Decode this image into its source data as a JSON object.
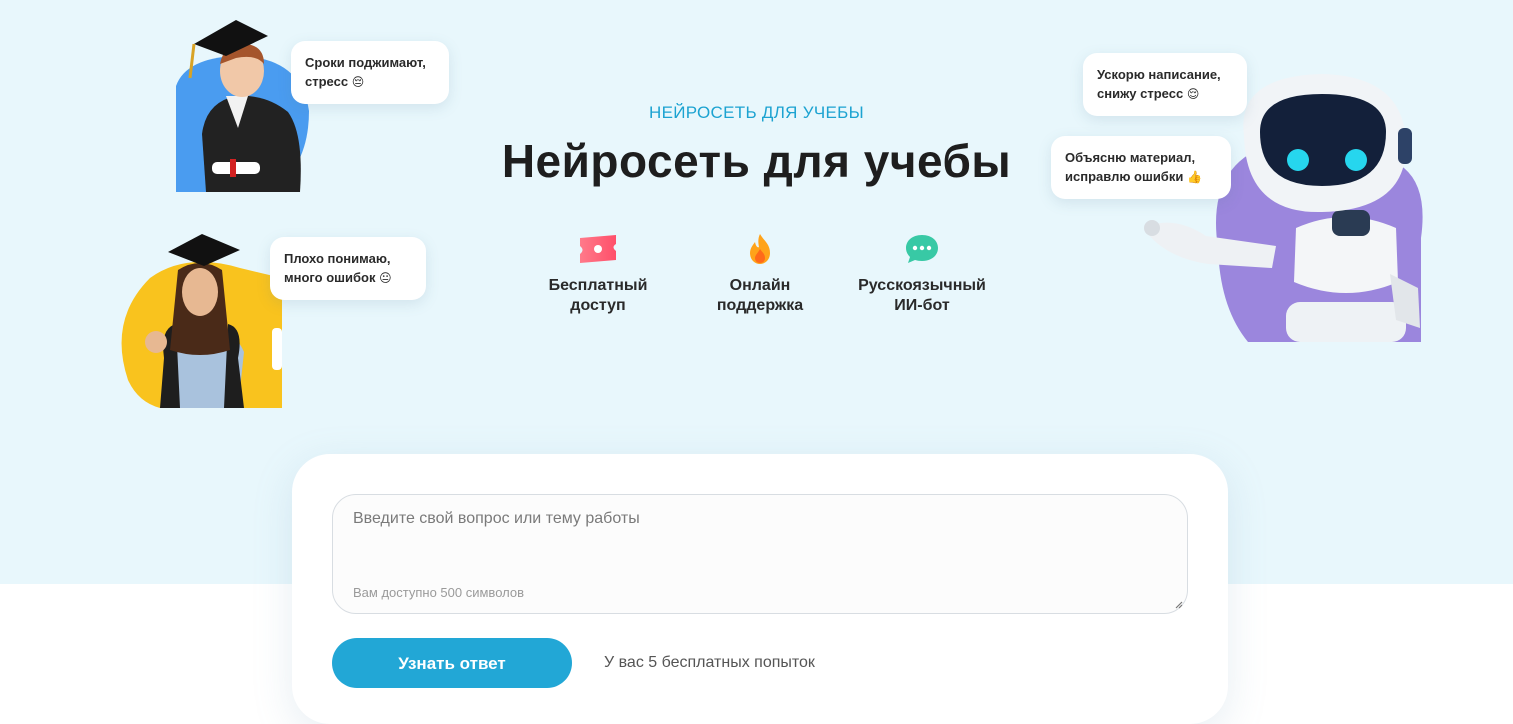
{
  "hero": {
    "eyebrow": "НЕЙРОСЕТЬ ДЛЯ УЧЕБЫ",
    "title": "Нейросеть для учебы"
  },
  "features": [
    {
      "icon": "ticket-icon",
      "line1": "Бесплатный",
      "line2": "доступ"
    },
    {
      "icon": "fire-icon",
      "line1": "Онлайн",
      "line2": "поддержка"
    },
    {
      "icon": "chat-icon",
      "line1": "Русскоязычный",
      "line2": "ИИ-бот"
    }
  ],
  "bubbles": {
    "student1": {
      "line1": "Сроки поджимают,",
      "line2": "стресс",
      "emoji": "😔"
    },
    "student2": {
      "line1": "Плохо понимаю,",
      "line2": "много ошибок",
      "emoji": "😐"
    },
    "robot1": {
      "line1": "Ускорю написание,",
      "line2": "снижу стресс",
      "emoji": "😌"
    },
    "robot2": {
      "line1": "Объясню материал,",
      "line2": "исправлю ошибки",
      "emoji": "👍"
    }
  },
  "form": {
    "placeholder": "Введите свой вопрос или тему работы",
    "char_limit": "Вам доступно 500 символов",
    "submit_label": "Узнать ответ",
    "attempts": "У вас 5 бесплатных попыток"
  },
  "colors": {
    "hero_bg": "#e8f7fc",
    "accent": "#22a7d6",
    "eyebrow": "#1ca3d1",
    "purple_blob": "#9b86dd",
    "yellow_blob": "#f9c31e",
    "blue_blob": "#4a9cf0"
  }
}
